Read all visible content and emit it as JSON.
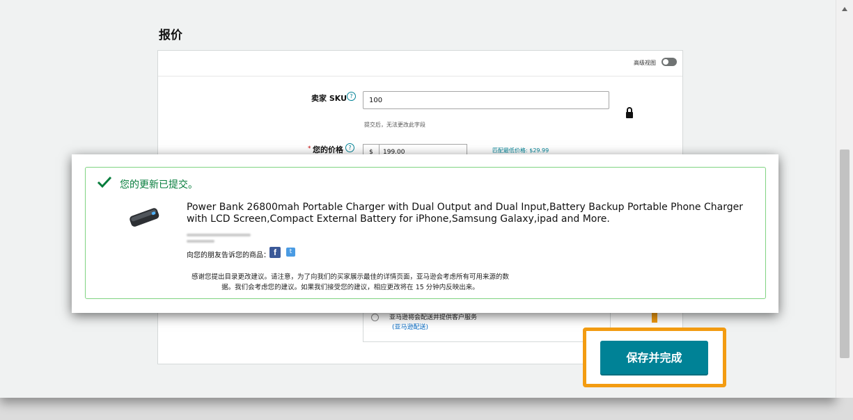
{
  "page": {
    "title": "报价"
  },
  "header": {
    "advanced_view_label": "高级视图"
  },
  "form": {
    "sku": {
      "label": "卖家 SKU",
      "value": "100",
      "hint": "提交后，无法更改此字段"
    },
    "price": {
      "required_mark": "*",
      "label": "您的价格",
      "currency": "$",
      "value": "199.00",
      "match_lowest_price": "匹配最低价格: $29.99"
    },
    "fulfillment": {
      "option_text": "亚马逊将会配送并提供客户服务",
      "option_link": "(亚马逊配送)"
    }
  },
  "actions": {
    "save_label": "保存并完成"
  },
  "popup": {
    "title": "您的更新已提交。",
    "product_title": "Power Bank 26800mah Portable Charger with Dual Output and Dual Input,Battery Backup Portable Phone Charger with LCD Screen,Compact External Battery for iPhone,Samsung Galaxy,ipad and More.",
    "share_label": "向您的朋友告诉您的商品：",
    "notice_line1": "感谢您提出目录更改建议。请注意，为了向我们的买家展示最佳的详情页面，亚马逊会考虑所有可用来源的数",
    "notice_line2": "据。我们会考虑您的建议。如果我们接受您的建议，相应更改将在 15 分钟内反映出来。"
  },
  "colors": {
    "accent": "#008296",
    "highlight": "#f39c12",
    "success": "#067d3c",
    "success_border": "#7fd381"
  },
  "icons": [
    "help-icon",
    "lock-icon",
    "check-icon",
    "facebook-icon",
    "twitter-icon",
    "arrow-up-icon"
  ]
}
